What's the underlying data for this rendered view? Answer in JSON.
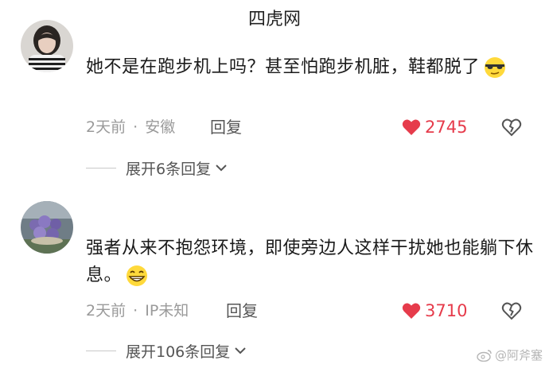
{
  "header": {
    "watermark": "四虎网"
  },
  "comments": [
    {
      "text": "她不是在跑步机上吗？甚至怕跑步机脏，鞋都脱了",
      "emoji": "sunglasses-emoji",
      "time": "2天前",
      "separator": "·",
      "location": "安徽",
      "reply_label": "回复",
      "likes": "2745",
      "expand_label": "展开6条回复"
    },
    {
      "text": "强者从来不抱怨环境，即使旁边人这样干扰她也能躺下休息。",
      "emoji": "grin-emoji",
      "time": "2天前",
      "separator": "·",
      "location": "IP未知",
      "reply_label": "回复",
      "likes": "3710",
      "expand_label": "展开106条回复"
    }
  ],
  "footer": {
    "watermark": "@阿斧塞"
  },
  "colors": {
    "like_red": "#e63b4b",
    "meta_gray": "#9a9a9a",
    "text": "#1a1a1a"
  }
}
